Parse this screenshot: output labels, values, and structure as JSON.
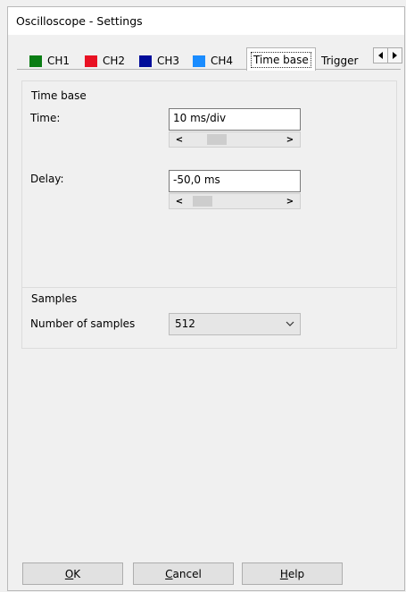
{
  "window": {
    "title": "Oscilloscope - Settings"
  },
  "tabs": [
    {
      "label": "CH1",
      "color": "#0a7d14"
    },
    {
      "label": "CH2",
      "color": "#e81123"
    },
    {
      "label": "CH3",
      "color": "#000c9a"
    },
    {
      "label": "CH4",
      "color": "#1a8cff"
    },
    {
      "label": "Time base",
      "active": true
    },
    {
      "label": "Trigger"
    }
  ],
  "tab_scroll": {
    "left_icon": "triangle-left-icon",
    "right_icon": "triangle-right-icon"
  },
  "timebase_group": {
    "title": "Time base",
    "time_label": "Time:",
    "time_value": "10  ms/div",
    "delay_label": "Delay:",
    "delay_value": "-50,0 ms"
  },
  "samples_group": {
    "title": "Samples",
    "num_label": "Number of samples",
    "num_value": "512"
  },
  "buttons": {
    "ok": {
      "mnemonic": "O",
      "rest": "K"
    },
    "cancel": {
      "mnemonic": "C",
      "rest": "ancel"
    },
    "help": {
      "mnemonic": "H",
      "rest": "elp"
    }
  }
}
